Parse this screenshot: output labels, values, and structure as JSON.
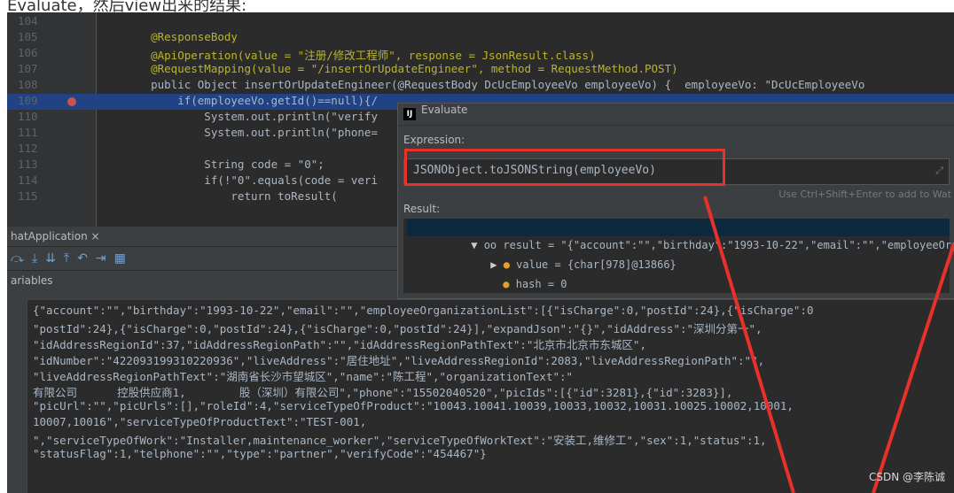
{
  "caption": "Evaluate，然后view出来的结果:",
  "editor": {
    "lines": [
      {
        "n": "104",
        "code": ""
      },
      {
        "n": "105",
        "code": "    @ResponseBody"
      },
      {
        "n": "106",
        "code": "    @ApiOperation(value = \"注册/修改工程师\", response = JsonResult.class)"
      },
      {
        "n": "107",
        "code": "    @RequestMapping(value = \"/insertOrUpdateEngineer\", method = RequestMethod.POST)"
      },
      {
        "n": "108",
        "code": "    public Object insertOrUpdateEngineer(@RequestBody DcUcEmployeeVo employeeVo) {  employeeVo: \"DcUcEmployeeVo"
      },
      {
        "n": "109",
        "code": "        if(employeeVo.getId()==null){/"
      },
      {
        "n": "110",
        "code": "            System.out.println(\"verify"
      },
      {
        "n": "111",
        "code": "            System.out.println(\"phone="
      },
      {
        "n": "112",
        "code": ""
      },
      {
        "n": "113",
        "code": "            String code = \"0\";"
      },
      {
        "n": "114",
        "code": "            if(!\"0\".equals(code = veri"
      },
      {
        "n": "115",
        "code": "                return toResult("
      }
    ]
  },
  "debug": {
    "tab": "hatApplication ×",
    "variables_label": "ariables"
  },
  "evaluate": {
    "title": "Evaluate",
    "logo": "IJ",
    "expression_label": "Expression:",
    "expression": "JSONObject.toJSONString(employeeVo)",
    "hint": "Use Ctrl+Shift+Enter to add to Wat",
    "result_label": "Result:",
    "result_row": "oo result = \"{\"account\":\"\",\"birthday\":\"1993-10-22\",\"email\":\"\",\"employeeOrganizationList\"···",
    "value_row": "value = {char[978]@13866}",
    "hash_row": "hash = 0"
  },
  "result_lines": [
    "{\"account\":\"\",\"birthday\":\"1993-10-22\",\"email\":\"\",\"employeeOrganizationList\":[{\"isCharge\":0,\"postId\":24},{\"isCharge\":0",
    "\"postId\":24},{\"isCharge\":0,\"postId\":24},{\"isCharge\":0,\"postId\":24}],\"expandJson\":\"{}\",\"idAddress\":\"深圳分第一\",",
    "\"idAddressRegionId\":37,\"idAddressRegionPath\":\"\",\"idAddressRegionPathText\":\"北京市北京市东城区\",",
    "\"idNumber\":\"422093199310220936\",\"liveAddress\":\"居住地址\",\"liveAddressRegionId\":2083,\"liveAddressRegionPath\":\"\",",
    "\"liveAddressRegionPathText\":\"湖南省长沙市望城区\",\"name\":\"陈工程\",\"organizationText\":\"",
    "有限公司      控股供应商1,        股（深圳）有限公司\",\"phone\":\"15502040520\",\"picIds\":[{\"id\":3281},{\"id\":3283}],",
    "\"picUrl\":\"\",\"picUrls\":[],\"roleId\":4,\"serviceTypeOfProduct\":\"10043.10041.10039,10033,10032,10031.10025.10002,10001,",
    "10007,10016\",\"serviceTypeOfProductText\":\"TEST-001,",
    "\",\"serviceTypeOfWork\":\"Installer,maintenance_worker\",\"serviceTypeOfWorkText\":\"安装工,维修工\",\"sex\":1,\"status\":1,",
    "\"statusFlag\":1,\"telphone\":\"\",\"type\":\"partner\",\"verifyCode\":\"454467\"}"
  ],
  "watermark": "CSDN @李陈诚",
  "colors": {
    "highlight": "#214283",
    "annotation_red": "#e8312a"
  }
}
